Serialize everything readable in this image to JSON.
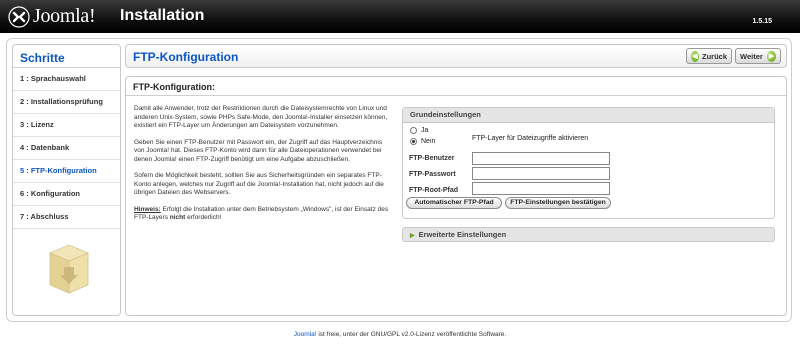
{
  "header": {
    "logo_text": "Joomla!",
    "title": "Installation",
    "version": "1.5.15"
  },
  "sidebar": {
    "heading": "Schritte",
    "steps": [
      {
        "label": "1 : Sprachauswahl"
      },
      {
        "label": "2 : Installationsprüfung"
      },
      {
        "label": "3 : Lizenz"
      },
      {
        "label": "4 : Datenbank"
      },
      {
        "label": "5 : FTP-Konfiguration",
        "active": true
      },
      {
        "label": "6 : Konfiguration"
      },
      {
        "label": "7 : Abschluss"
      }
    ]
  },
  "main": {
    "page_title": "FTP-Konfiguration",
    "back_label": "Zurück",
    "next_label": "Weiter",
    "section_title": "FTP-Konfiguration:",
    "description": [
      "Damit alle Anwender, trotz der Restriktionen durch die Dateisystemrechte von Linux und anderen Unix-System, sowie PHPs Safe-Mode, den Joomla!-Installer einsetzen können, existiert ein FTP-Layer um Änderungen am Dateisystem vorzunehmen.",
      "Geben Sie einen FTP-Benutzer mit Passwort ein, der Zugriff auf das Hauptverzeichnis von Joomla! hat. Dieses FTP-Konto wird dann für alle Dateioperationen verwendet bei denen Joomla! einen FTP-Zugriff benötigt um eine Aufgabe abzuschließen.",
      "Sofern die Möglichkeit besteht, sollten Sie aus Sicherheitsgründen ein separates FTP-Konto anlegen, welches nur Zugriff auf die Joomla!-Installation hat, nicht jedoch auf die übrigen Dateien des Webservers."
    ],
    "hint_label": "Hinweis:",
    "hint_text_1": " Erfolgt die Installation unter dem Betriebsystem „Windows\", ist der Einsatz des FTP-Layers ",
    "hint_bold": "nicht",
    "hint_text_2": " erforderlich!",
    "settings": {
      "heading": "Grundeinstellungen",
      "radio_yes": "Ja",
      "radio_no": "Nein",
      "radio_description": "FTP-Layer für Dateizugriffe aktivieren",
      "ftp_user_label": "FTP-Benutzer",
      "ftp_user_value": "",
      "ftp_password_label": "FTP-Passwort",
      "ftp_password_value": "",
      "ftp_root_label": "FTP-Root-Pfad",
      "ftp_root_value": "",
      "auto_path_button": "Automatischer FTP-Pfad",
      "confirm_button": "FTP-Einstellungen bestätigen"
    },
    "advanced_label": "Erweiterte Einstellungen"
  },
  "footer": {
    "link_text": "Joomla!",
    "text": " ist freie, unter der GNU/GPL v2.0-Lizenz veröffentlichte Software."
  }
}
